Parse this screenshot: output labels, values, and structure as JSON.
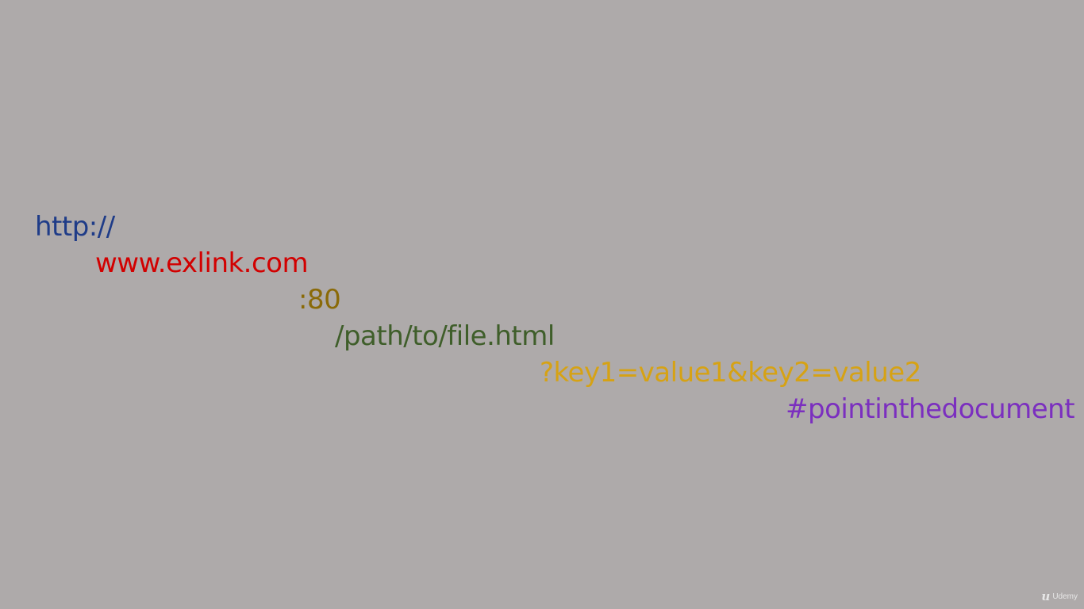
{
  "colors": {
    "background": "#aeaaaa",
    "protocol": "#1f3c88",
    "domain": "#d20000",
    "port": "#8a6a08",
    "path": "#3f5e2a",
    "query": "#d6a214",
    "fragment": "#7b2fbf"
  },
  "url_parts": {
    "protocol": "http://",
    "domain": "www.exlink.com",
    "port": ":80",
    "path": "/path/to/file.html",
    "query": "?key1=value1&key2=value2",
    "fragment": "#pointinthedocument"
  },
  "watermark": {
    "logo_glyph": "u",
    "brand": "Udemy",
    "icon": "udemy-logo-icon"
  }
}
